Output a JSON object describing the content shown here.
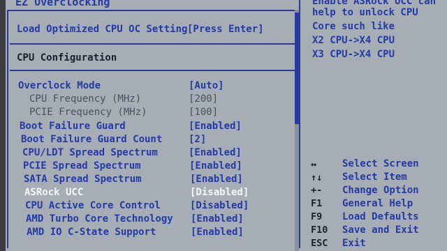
{
  "header": {
    "title": "EZ Overclocking"
  },
  "load_optimized": {
    "label": "Load Optimized CPU OC Setting",
    "value": "[Press Enter]"
  },
  "section_title": "CPU Configuration",
  "settings": [
    {
      "label": "Overclock Mode",
      "value": "[Auto]",
      "style": "blue"
    },
    {
      "label": "CPU Frequency (MHz)",
      "value": "[200]",
      "style": "gray"
    },
    {
      "label": "PCIE Frequency (MHz)",
      "value": "[100]",
      "style": "gray"
    },
    {
      "label": "Boot Failure Guard",
      "value": "[Enabled]",
      "style": "blue"
    },
    {
      "label": "Boot Failure Guard Count",
      "value": "[2]",
      "style": "blue"
    },
    {
      "label": "CPU/LDT Spread Spectrum",
      "value": "[Enabled]",
      "style": "blue"
    },
    {
      "label": "PCIE Spread Spectrum",
      "value": "[Enabled]",
      "style": "blue"
    },
    {
      "label": "SATA Spread Spectrum",
      "value": "[Enabled]",
      "style": "blue"
    },
    {
      "label": "ASRock UCC",
      "value": "[Disabled]",
      "style": "selected"
    },
    {
      "label": "CPU Active Core Control",
      "value": "[Disabled]",
      "style": "blue"
    },
    {
      "label": "AMD Turbo Core Technology",
      "value": "[Enabled]",
      "style": "blue"
    },
    {
      "label": "AMD IO C-State Support",
      "value": "[Enabled]",
      "style": "blue"
    }
  ],
  "help_text": [
    "Enable ASRock UCC can",
    "help to unlock CPU",
    "Core such like",
    "X2 CPU->X4 CPU",
    "X3 CPU->X4 CPU"
  ],
  "key_legend": [
    {
      "key": "↔",
      "desc": "Select Screen"
    },
    {
      "key": "↑↓",
      "desc": "Select Item"
    },
    {
      "key": "+-",
      "desc": "Change Option"
    },
    {
      "key": "F1",
      "desc": "General Help"
    },
    {
      "key": "F9",
      "desc": "Load Defaults"
    },
    {
      "key": "F10",
      "desc": "Save and Exit"
    },
    {
      "key": "ESC",
      "desc": "Exit"
    }
  ]
}
